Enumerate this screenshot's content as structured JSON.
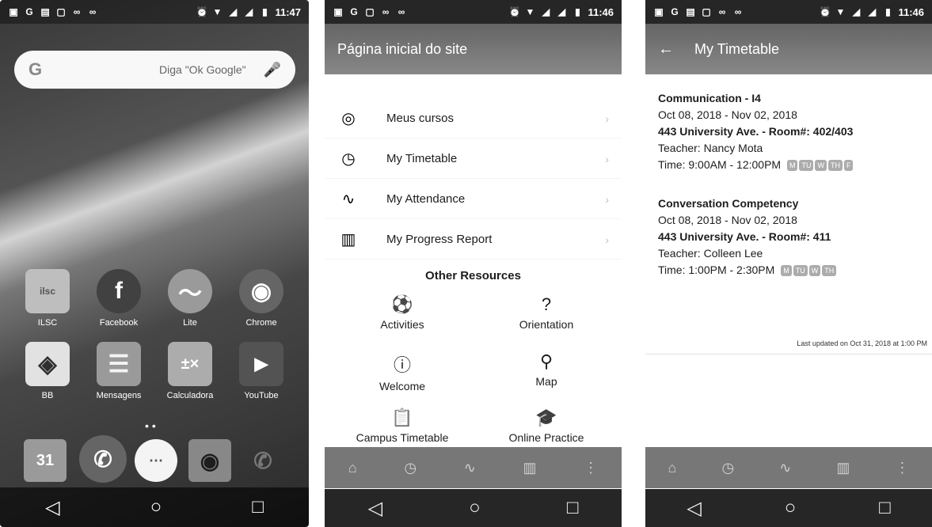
{
  "phone1": {
    "status_time": "11:47",
    "search_hint": "Diga \"Ok Google\"",
    "apps_row1": [
      {
        "label": "ILSC",
        "icon": "ilsc-icon"
      },
      {
        "label": "Facebook",
        "icon": "facebook-icon"
      },
      {
        "label": "Lite",
        "icon": "messenger-icon"
      },
      {
        "label": "Chrome",
        "icon": "chrome-icon"
      }
    ],
    "apps_row2": [
      {
        "label": "BB",
        "icon": "bb-icon"
      },
      {
        "label": "Mensagens",
        "icon": "messages-icon"
      },
      {
        "label": "Calculadora",
        "icon": "calculator-icon"
      },
      {
        "label": "YouTube",
        "icon": "youtube-icon"
      }
    ],
    "calendar_day": "31"
  },
  "phone2": {
    "status_time": "11:46",
    "title": "Página inicial do site",
    "menu": [
      {
        "label": "Meus cursos",
        "icon": "courses-icon"
      },
      {
        "label": "My Timetable",
        "icon": "timetable-icon"
      },
      {
        "label": "My Attendance",
        "icon": "attendance-icon"
      },
      {
        "label": "My Progress Report",
        "icon": "progress-icon"
      }
    ],
    "resources_title": "Other Resources",
    "resources": [
      {
        "label": "Activities",
        "icon": "soccer-icon"
      },
      {
        "label": "Orientation",
        "icon": "question-icon"
      },
      {
        "label": "Welcome",
        "icon": "info-icon"
      },
      {
        "label": "Map",
        "icon": "map-pin-icon"
      },
      {
        "label": "Campus Timetable",
        "icon": "clipboard-icon"
      },
      {
        "label": "Online Practice",
        "icon": "graduation-cap-icon"
      }
    ]
  },
  "phone3": {
    "status_time": "11:46",
    "title": "My Timetable",
    "entries": [
      {
        "course": "Communication - I4",
        "dates": "Oct 08, 2018 - Nov 02, 2018",
        "location": "443 University Ave. - Room#: 402/403",
        "teacher": "Teacher: Nancy Mota",
        "time": "Time: 9:00AM - 12:00PM",
        "days": [
          "M",
          "TU",
          "W",
          "TH",
          "F"
        ]
      },
      {
        "course": "Conversation Competency",
        "dates": "Oct 08, 2018 - Nov 02, 2018",
        "location": "443 University Ave. - Room#: 411",
        "teacher": "Teacher: Colleen Lee",
        "time": "Time: 1:00PM - 2:30PM",
        "days": [
          "M",
          "TU",
          "W",
          "TH"
        ]
      }
    ],
    "updated": "Last updated on Oct 31, 2018 at 1:00 PM"
  }
}
